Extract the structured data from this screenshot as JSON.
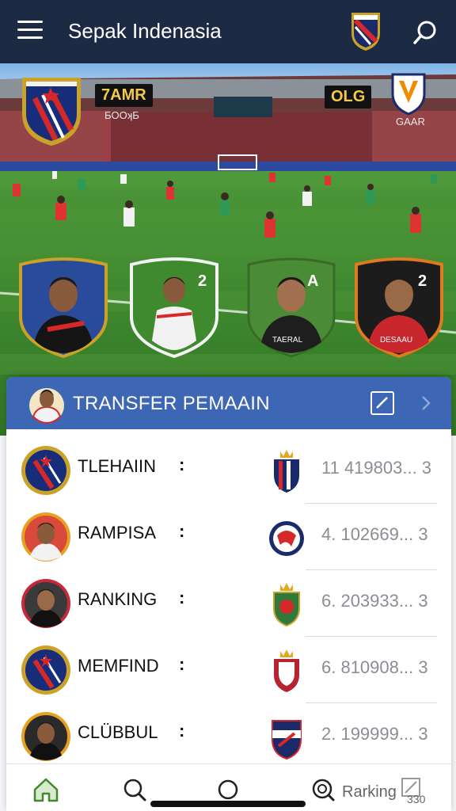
{
  "app": {
    "title": "Sepak Indenasia"
  },
  "hero": {
    "score_left": "7AMR",
    "score_left_sub": "ƂOOʞƂ",
    "score_right": "OLG",
    "score_right_sub": "GAAR",
    "cards": [
      {
        "number": "",
        "jersey": ""
      },
      {
        "number": "2",
        "jersey": ""
      },
      {
        "number": "A",
        "jersey": "TAERAL"
      },
      {
        "number": "2",
        "jersey": "DESAAU"
      }
    ]
  },
  "panel": {
    "title": "TRANSFER PEMAAIN",
    "rows": [
      {
        "name": "TLEHAIIN",
        "separator": ":",
        "value": "11 419803... 3"
      },
      {
        "name": "RAMPISA",
        "separator": ":",
        "value": "4. 102669... 3"
      },
      {
        "name": "RANKING",
        "separator": ":",
        "value": "6. 203933... 3"
      },
      {
        "name": "MEMFIND",
        "separator": ":",
        "value": "6. 810908... 3"
      },
      {
        "name": "CLÜBBUL",
        "separator": ":",
        "value": "2. 199999... 3"
      }
    ]
  },
  "nav": {
    "ranking_label": "Rarking",
    "ranking_badge": "330"
  },
  "colors": {
    "topbar": "#1d2a44",
    "panel_header": "#3d66b5",
    "pitch": "#3f8a2f"
  }
}
